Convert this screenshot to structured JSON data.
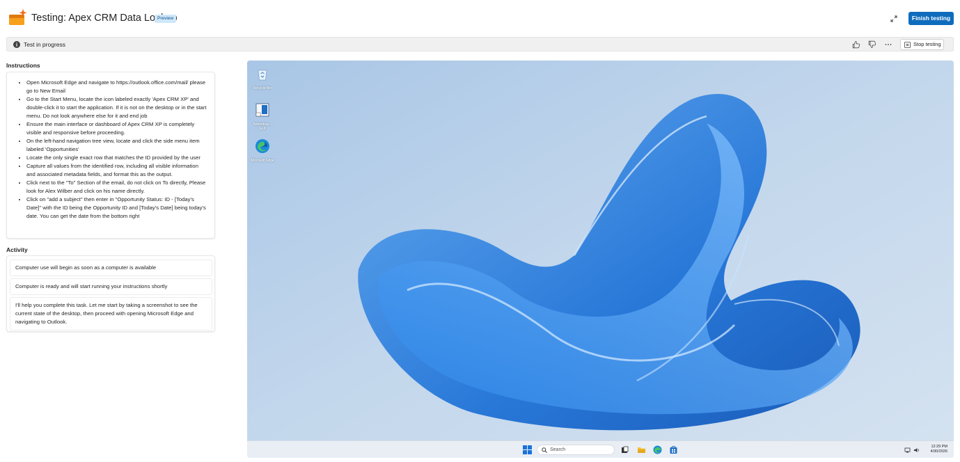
{
  "header": {
    "title": "Testing: Apex CRM Data Lookup",
    "badge": "Preview",
    "finish_label": "Finish testing"
  },
  "status": {
    "text": "Test in progress",
    "stop_label": "Stop testing"
  },
  "instructions": {
    "label": "Instructions",
    "items": [
      "Open Microsoft Edge and navigate to https://outlook.office.com/mail/ please go to New Email",
      "Go to the Start Menu, locate the icon labeled exactly 'Apex CRM XP' and double-click it to start the application. If it is not on the desktop or in the start menu. Do not look anywhere else for it and end job",
      "Ensure the main interface or dashboard of Apex CRM XP is completely visible and responsive before proceeding.",
      "On the left-hand navigation tree view, locate and click the side menu item labeled 'Opportunities'",
      "Locate the only single exact row that matches the ID provided by the user",
      "Capture all values from the identified row, including all visible information and associated metadata fields, and format this as the output.",
      "Click next to the \"To\" Section of the email, do not click on To directly, Please look for Alex Wilber and click on his name directly.",
      "Click on \"add a subject\" then enter in \"Opportunity Status: ID - [Today's Date]\" with the ID being the Opportunity ID and [Today's Date] being today's date. You can get the date from the bottom right"
    ]
  },
  "activity": {
    "label": "Activity",
    "items": [
      "Computer use will begin as soon as a computer is available",
      "Computer is ready and will start running your instructions shortly",
      "I'll help you complete this task. Let me start by taking a screenshot to see the current state of the desktop, then proceed with opening Microsoft Edge and navigating to Outlook."
    ]
  },
  "desktop": {
    "icons": [
      {
        "label": "Recycle Bin",
        "icon": "recycle-bin-icon"
      },
      {
        "label": "Adventure... GUI",
        "icon": "adventure-app-icon"
      },
      {
        "label": "Microsoft Edge",
        "icon": "edge-icon"
      }
    ],
    "taskbar": {
      "search_placeholder": "Search",
      "time": "12:29 PM",
      "date": "4/30/2026"
    }
  },
  "colors": {
    "accent": "#0f6cbd",
    "badge_bg": "#cfe7f8",
    "status_bg": "#f0f0f0"
  }
}
